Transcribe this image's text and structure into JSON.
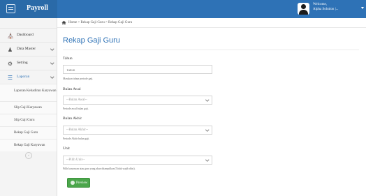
{
  "app": {
    "title": "Payroll"
  },
  "user": {
    "line1": "Welcome,",
    "line2": "Alpha Solution |..."
  },
  "sidebar": {
    "items": [
      {
        "label": "Dashboard",
        "icon": "dashboard-icon"
      },
      {
        "label": "Data Master",
        "icon": "user-icon"
      },
      {
        "label": "Setting",
        "icon": "gears-icon"
      },
      {
        "label": "Laporan",
        "icon": "book-icon"
      }
    ],
    "sub_items": [
      {
        "label": "Laporan Kehadiran Karyawan"
      },
      {
        "label": "Slip Gaji Karyawan"
      },
      {
        "label": "Slip Gaji Guru"
      },
      {
        "label": "Rekap Gaji Guru"
      },
      {
        "label": "Rekap Gaji Karyawan"
      }
    ]
  },
  "breadcrumb": {
    "text": "Home > Rekap Gaji Guru > Rekap Gaji Guru"
  },
  "page": {
    "title": "Rekap Gaji Guru"
  },
  "form": {
    "tahun": {
      "label": "Tahun",
      "placeholder": "Tahun",
      "help": "Masukan tahun periode gaji."
    },
    "bulan_awal": {
      "label": "Bulan Awal",
      "value": "--Bulan Awal--",
      "help": "Periode awal bulan gaji."
    },
    "bulan_akhir": {
      "label": "Bulan Akhir",
      "value": "--Bulan Akhir--",
      "help": "Periode Akhir bulan gaji."
    },
    "unit": {
      "label": "Unit",
      "value": "--Pilih Unit--",
      "help": "Pilih karyawan atau guru yang akan ditampilkan (Tidak wajib diisi)."
    },
    "submit_label": "Preview"
  },
  "colors": {
    "topbar": "#2e72b6",
    "accent": "#2e72b6",
    "button": "#4ba64b"
  }
}
